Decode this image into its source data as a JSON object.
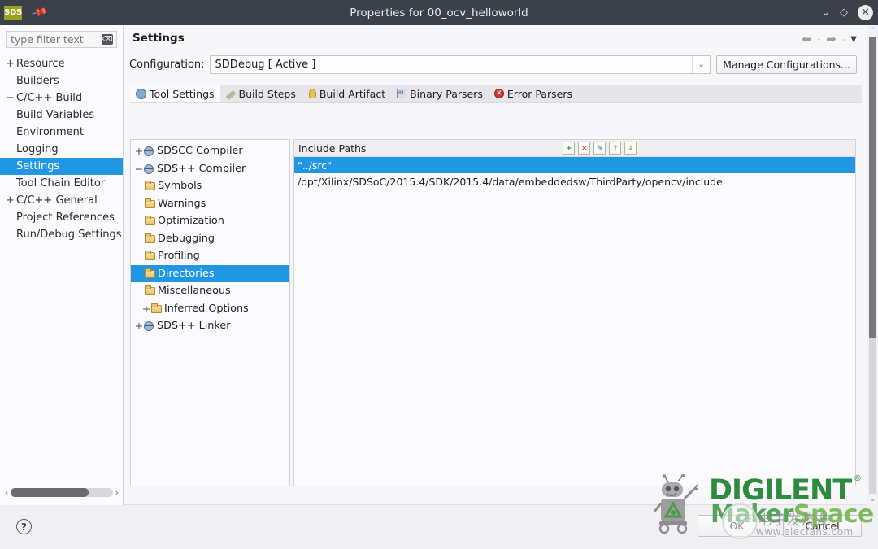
{
  "titlebar": {
    "app_badge": "SDS",
    "pin_icon": "pin-icon",
    "title": "Properties for 00_ocv_helloworld",
    "minimize_label": "⌄",
    "maximize_label": "◇",
    "close_label": "✕"
  },
  "filter": {
    "placeholder": "type filter text",
    "clear_label": "⌫"
  },
  "sidebar": {
    "items": [
      {
        "label": "Resource",
        "expander": "+",
        "indent": 0,
        "selected": false
      },
      {
        "label": "Builders",
        "expander": "",
        "indent": 0,
        "selected": false
      },
      {
        "label": "C/C++ Build",
        "expander": "−",
        "indent": 0,
        "selected": false
      },
      {
        "label": "Build Variables",
        "expander": "",
        "indent": 1,
        "selected": false
      },
      {
        "label": "Environment",
        "expander": "",
        "indent": 1,
        "selected": false
      },
      {
        "label": "Logging",
        "expander": "",
        "indent": 1,
        "selected": false
      },
      {
        "label": "Settings",
        "expander": "",
        "indent": 1,
        "selected": true
      },
      {
        "label": "Tool Chain Editor",
        "expander": "",
        "indent": 1,
        "selected": false
      },
      {
        "label": "C/C++ General",
        "expander": "+",
        "indent": 0,
        "selected": false
      },
      {
        "label": "Project References",
        "expander": "",
        "indent": 0,
        "selected": false
      },
      {
        "label": "Run/Debug Settings",
        "expander": "",
        "indent": 0,
        "selected": false
      }
    ]
  },
  "header": {
    "page_title": "Settings",
    "nav_back": "⬅",
    "nav_back_chevron": "⌄",
    "nav_forward": "➡",
    "nav_forward_chevron": "⌄",
    "nav_menu": "▼"
  },
  "config": {
    "label": "Configuration:",
    "value": "SDDebug  [ Active ]",
    "dropdown_arrow": "⌄",
    "manage_button": "Manage Configurations..."
  },
  "tabs": [
    {
      "label": "Tool Settings",
      "icon": "globe-icon",
      "active": true
    },
    {
      "label": "Build Steps",
      "icon": "wrench-icon",
      "active": false
    },
    {
      "label": "Build Artifact",
      "icon": "lightbulb-icon",
      "active": false
    },
    {
      "label": "Binary Parsers",
      "icon": "binary-icon",
      "active": false
    },
    {
      "label": "Error Parsers",
      "icon": "error-icon",
      "active": false
    }
  ],
  "tool_tree": [
    {
      "label": "SDSCC Compiler",
      "expander": "+",
      "icon": "gear-icon",
      "indent": 0,
      "selected": false
    },
    {
      "label": "SDS++ Compiler",
      "expander": "−",
      "icon": "gear-icon",
      "indent": 0,
      "selected": false
    },
    {
      "label": "Symbols",
      "expander": "",
      "icon": "folder-icon",
      "indent": 1,
      "selected": false
    },
    {
      "label": "Warnings",
      "expander": "",
      "icon": "folder-icon",
      "indent": 1,
      "selected": false
    },
    {
      "label": "Optimization",
      "expander": "",
      "icon": "folder-icon",
      "indent": 1,
      "selected": false
    },
    {
      "label": "Debugging",
      "expander": "",
      "icon": "folder-icon",
      "indent": 1,
      "selected": false
    },
    {
      "label": "Profiling",
      "expander": "",
      "icon": "folder-icon",
      "indent": 1,
      "selected": false
    },
    {
      "label": "Directories",
      "expander": "",
      "icon": "folder-icon",
      "indent": 1,
      "selected": true
    },
    {
      "label": "Miscellaneous",
      "expander": "",
      "icon": "folder-icon",
      "indent": 1,
      "selected": false
    },
    {
      "label": "Inferred Options",
      "expander": "+",
      "icon": "folder-icon",
      "indent": 2,
      "selected": false
    },
    {
      "label": "SDS++ Linker",
      "expander": "+",
      "icon": "gear-icon",
      "indent": 0,
      "selected": false
    }
  ],
  "include_paths": {
    "header": "Include Paths",
    "toolbar": [
      {
        "name": "add-icon",
        "glyph": "+",
        "color": "#1f9b34"
      },
      {
        "name": "delete-icon",
        "glyph": "✕",
        "color": "#cc2d24"
      },
      {
        "name": "edit-icon",
        "glyph": "✎",
        "color": "#3b6fa8"
      },
      {
        "name": "move-up-icon",
        "glyph": "↑",
        "color": "#6d6d72"
      },
      {
        "name": "move-down-icon",
        "glyph": "↓",
        "color": "#c8921f"
      }
    ],
    "rows": [
      {
        "value": "\"../src\"",
        "selected": true
      },
      {
        "value": "/opt/Xilinx/SDSoC/2015.4/SDK/2015.4/data/embeddedsw/ThirdParty/opencv/include",
        "selected": false
      }
    ]
  },
  "scrollbars": {
    "vertical_up": "⌃",
    "vertical_down": "⌄",
    "horizontal_left": "‹",
    "horizontal_right": "›"
  },
  "footer": {
    "help_label": "?",
    "ok_label": "OK",
    "cancel_label": "Cancel"
  },
  "watermark": {
    "brand": "DIGILENT",
    "registered": "®",
    "sub_brand_a": "Maker",
    "sub_brand_b": "Space",
    "cn_text": "电子发烧友",
    "url": "www.elecfans.com"
  },
  "colors": {
    "selection_blue": "#2196e3",
    "titlebar": "#3c4048",
    "badge_olive": "#9aa11a",
    "brand_green": "#2d8a3e"
  }
}
